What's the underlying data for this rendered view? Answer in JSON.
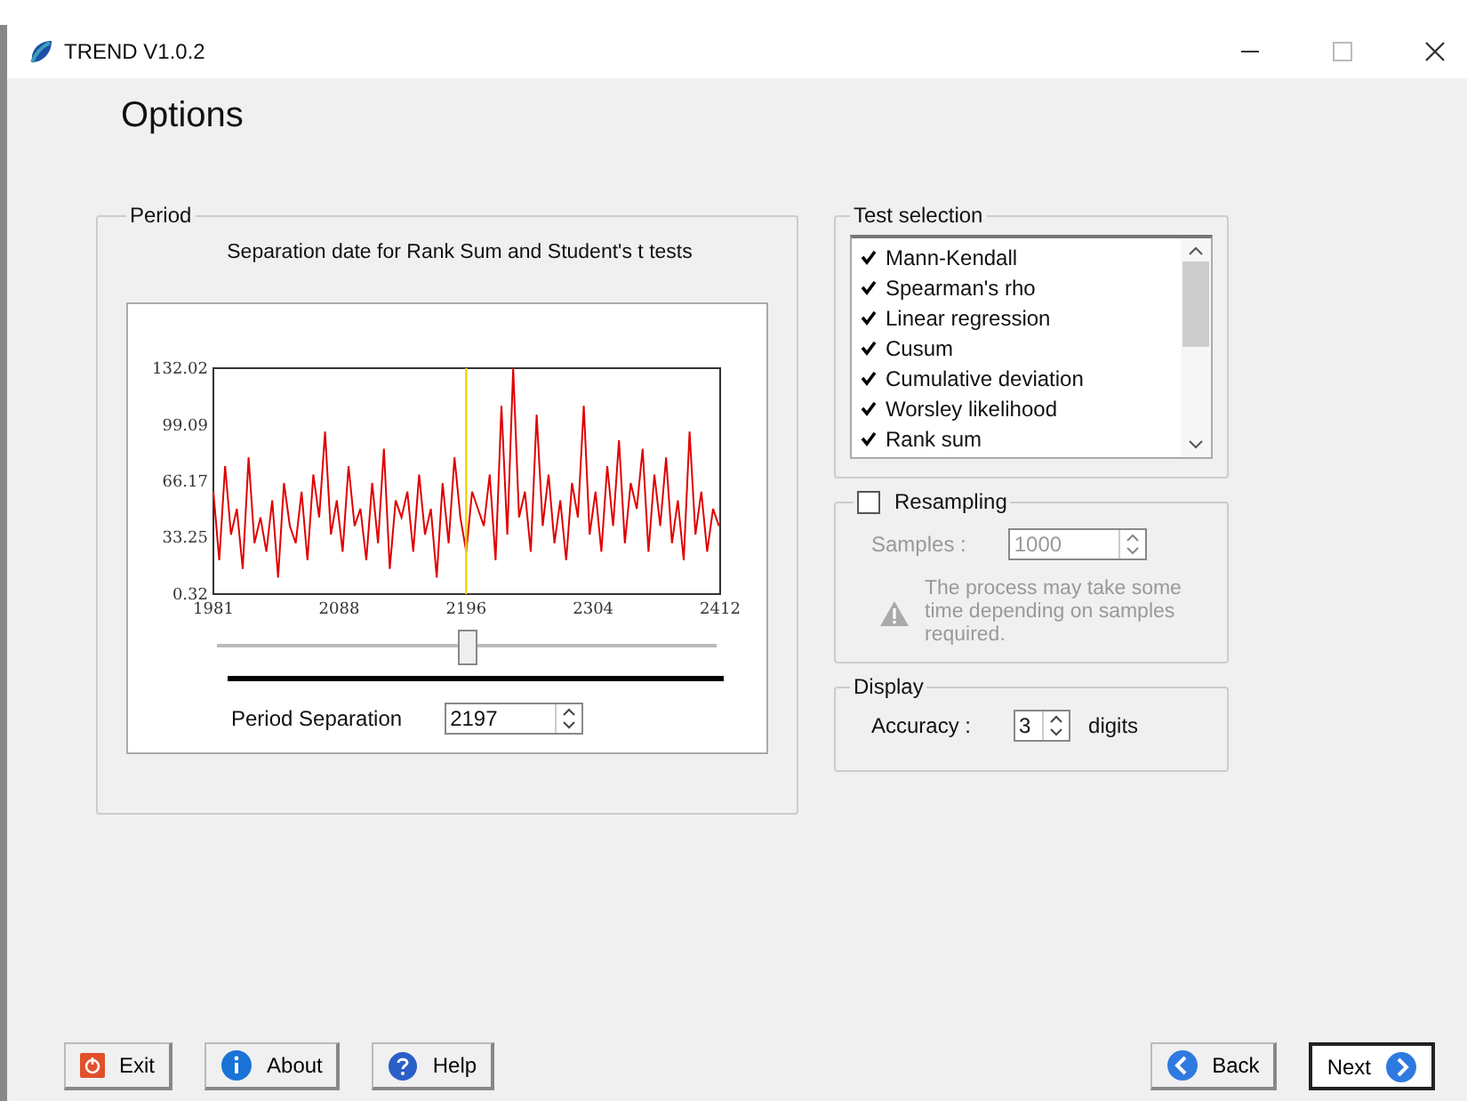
{
  "window": {
    "title": "TREND V1.0.2"
  },
  "heading": "Options",
  "period": {
    "label": "Period",
    "caption": "Separation date for Rank Sum and Student's t tests",
    "chart_data": {
      "type": "line",
      "xlim": [
        1981,
        2412
      ],
      "ylim": [
        0.32,
        132.02
      ],
      "xticks": [
        1981,
        2088,
        2196,
        2304,
        2412
      ],
      "yticks": [
        0.32,
        33.25,
        66.17,
        99.09,
        132.02
      ],
      "x": [
        1981,
        1986,
        1991,
        1996,
        2001,
        2006,
        2011,
        2016,
        2021,
        2026,
        2031,
        2036,
        2041,
        2046,
        2051,
        2056,
        2061,
        2066,
        2071,
        2076,
        2081,
        2086,
        2091,
        2096,
        2101,
        2106,
        2111,
        2116,
        2121,
        2126,
        2131,
        2136,
        2141,
        2146,
        2151,
        2156,
        2161,
        2166,
        2171,
        2176,
        2181,
        2186,
        2191,
        2196,
        2201,
        2206,
        2211,
        2216,
        2221,
        2226,
        2231,
        2236,
        2241,
        2246,
        2251,
        2256,
        2261,
        2266,
        2271,
        2276,
        2281,
        2286,
        2291,
        2296,
        2301,
        2306,
        2311,
        2316,
        2321,
        2326,
        2331,
        2336,
        2341,
        2346,
        2351,
        2356,
        2361,
        2366,
        2371,
        2376,
        2381,
        2386,
        2391,
        2396,
        2401,
        2406,
        2411
      ],
      "ref_lines": [
        {
          "axis": "x",
          "value": 2196,
          "color": "#f5d000"
        }
      ],
      "series": [
        {
          "color": "#e00000",
          "values": [
            60,
            20,
            75,
            35,
            50,
            15,
            80,
            30,
            45,
            25,
            55,
            10,
            65,
            40,
            30,
            60,
            20,
            70,
            45,
            95,
            35,
            55,
            25,
            75,
            40,
            50,
            20,
            65,
            30,
            85,
            15,
            55,
            45,
            60,
            25,
            70,
            35,
            50,
            10,
            65,
            30,
            80,
            45,
            25,
            60,
            50,
            40,
            70,
            20,
            110,
            35,
            132,
            45,
            60,
            25,
            105,
            40,
            70,
            30,
            55,
            20,
            65,
            45,
            110,
            35,
            60,
            25,
            75,
            40,
            90,
            30,
            65,
            50,
            85,
            25,
            70,
            40,
            80,
            30,
            55,
            20,
            95,
            35,
            60,
            25,
            50,
            40
          ]
        }
      ]
    },
    "slider": {
      "level": 0.5
    },
    "separation": {
      "label": "Period Separation",
      "value": "2197"
    }
  },
  "test_selection": {
    "label": "Test selection",
    "items": [
      {
        "label": "Mann-Kendall",
        "checked": true
      },
      {
        "label": "Spearman's rho",
        "checked": true
      },
      {
        "label": "Linear regression",
        "checked": true
      },
      {
        "label": "Cusum",
        "checked": true
      },
      {
        "label": "Cumulative deviation",
        "checked": true
      },
      {
        "label": "Worsley likelihood",
        "checked": true
      },
      {
        "label": "Rank sum",
        "checked": true
      }
    ]
  },
  "resampling": {
    "label": "Resampling",
    "checked": false,
    "samples_label": "Samples :",
    "samples_value": "1000",
    "note": "The process may take some time depending on samples required."
  },
  "display": {
    "label": "Display",
    "accuracy_label": "Accuracy :",
    "accuracy_value": "3",
    "unit": "digits"
  },
  "left_buttons": [
    {
      "kind": "exit",
      "label": "Exit",
      "focused": false
    },
    {
      "kind": "about",
      "label": "About",
      "focused": false
    },
    {
      "kind": "help",
      "label": "Help",
      "focused": false
    }
  ],
  "right_buttons": [
    {
      "kind": "back",
      "label": "Back",
      "focused": false
    },
    {
      "kind": "next",
      "label": "Next",
      "focused": true
    }
  ]
}
